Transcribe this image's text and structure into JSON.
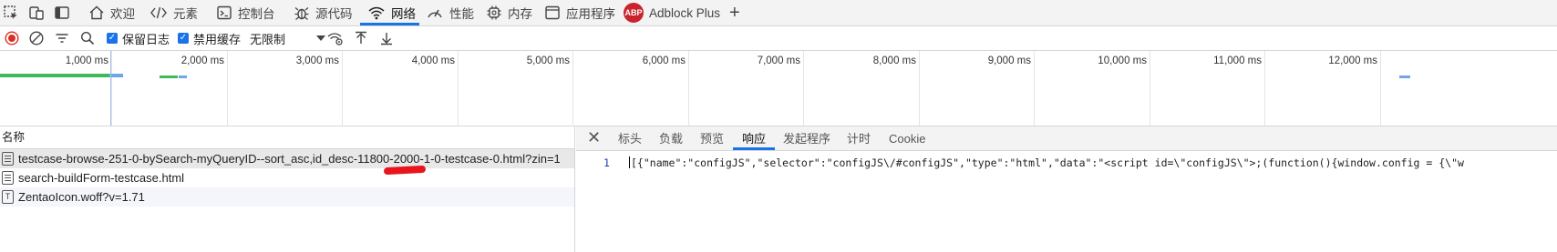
{
  "tabs": [
    {
      "label": "欢迎",
      "icon": "home-icon"
    },
    {
      "label": "元素",
      "icon": "code-icon"
    },
    {
      "label": "控制台",
      "icon": "console-icon"
    },
    {
      "label": "源代码",
      "icon": "bug-icon"
    },
    {
      "label": "网络",
      "icon": "wifi-icon",
      "active": true
    },
    {
      "label": "性能",
      "icon": "gauge-icon"
    },
    {
      "label": "内存",
      "icon": "chip-icon"
    },
    {
      "label": "应用程序",
      "icon": "window-icon"
    },
    {
      "label": "Adblock Plus",
      "icon": "abp-icon",
      "badge": "ABP"
    }
  ],
  "toolbar": {
    "preserve_log_label": "保留日志",
    "disable_cache_label": "禁用缓存",
    "throttle_label": "无限制"
  },
  "timeline": {
    "ticks": [
      "1,000 ms",
      "2,000 ms",
      "3,000 ms",
      "4,000 ms",
      "5,000 ms",
      "6,000 ms",
      "7,000 ms",
      "8,000 ms",
      "9,000 ms",
      "10,000 ms",
      "11,000 ms",
      "12,000 ms"
    ]
  },
  "requests": {
    "header": "名称",
    "rows": [
      {
        "name": "testcase-browse-251-0-bySearch-myQueryID--sort_asc,id_desc-11800-2000-1-0-testcase-0.html?zin=1",
        "icon": "document-icon",
        "selected": true
      },
      {
        "name": "search-buildForm-testcase.html",
        "icon": "document-icon"
      },
      {
        "name": "ZentaoIcon.woff?v=1.71",
        "icon": "font-icon"
      }
    ]
  },
  "detail": {
    "tabs": [
      "标头",
      "负载",
      "预览",
      "响应",
      "发起程序",
      "计时",
      "Cookie"
    ],
    "active_tab": "响应",
    "line_number": "1",
    "response_text": "[{\"name\":\"configJS\",\"selector\":\"configJS\\/#configJS\",\"type\":\"html\",\"data\":\"<script id=\\\"configJS\\\">;(function(){window.config = {\\\"w"
  },
  "colors": {
    "accent": "#1a73e8",
    "record": "#d93025",
    "timeline_green": "#3dba5a",
    "timeline_blue": "#6ea6e8",
    "annotation_red": "#e8151c"
  }
}
